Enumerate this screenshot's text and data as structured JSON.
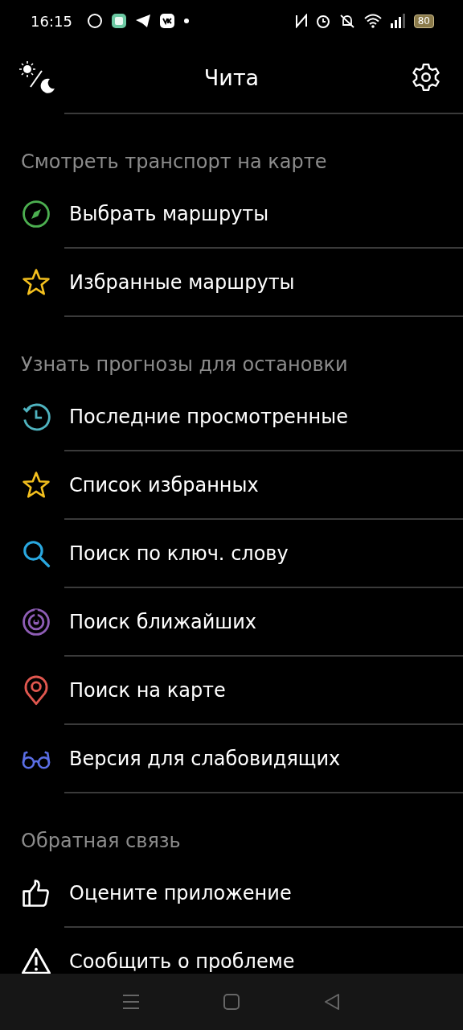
{
  "status_bar": {
    "time": "16:15",
    "battery": "80"
  },
  "header": {
    "title": "Чита"
  },
  "sections": [
    {
      "title": "Смотреть транспорт на карте",
      "items": [
        {
          "kind": "compass",
          "label": "Выбрать маршруты"
        },
        {
          "kind": "star",
          "label": "Избранные маршруты"
        }
      ]
    },
    {
      "title": "Узнать прогнозы для остановки",
      "items": [
        {
          "kind": "history",
          "label": "Последние просмотренные"
        },
        {
          "kind": "star",
          "label": "Список избранных"
        },
        {
          "kind": "search",
          "label": "Поиск по ключ. слову"
        },
        {
          "kind": "radar",
          "label": "Поиск ближайших"
        },
        {
          "kind": "pin",
          "label": "Поиск на карте"
        },
        {
          "kind": "glasses",
          "label": "Версия для слабовидящих"
        }
      ]
    },
    {
      "title": "Обратная связь",
      "items": [
        {
          "kind": "thumb",
          "label": "Оцените приложение"
        },
        {
          "kind": "warning",
          "label": "Сообщить о проблеме"
        }
      ]
    }
  ]
}
